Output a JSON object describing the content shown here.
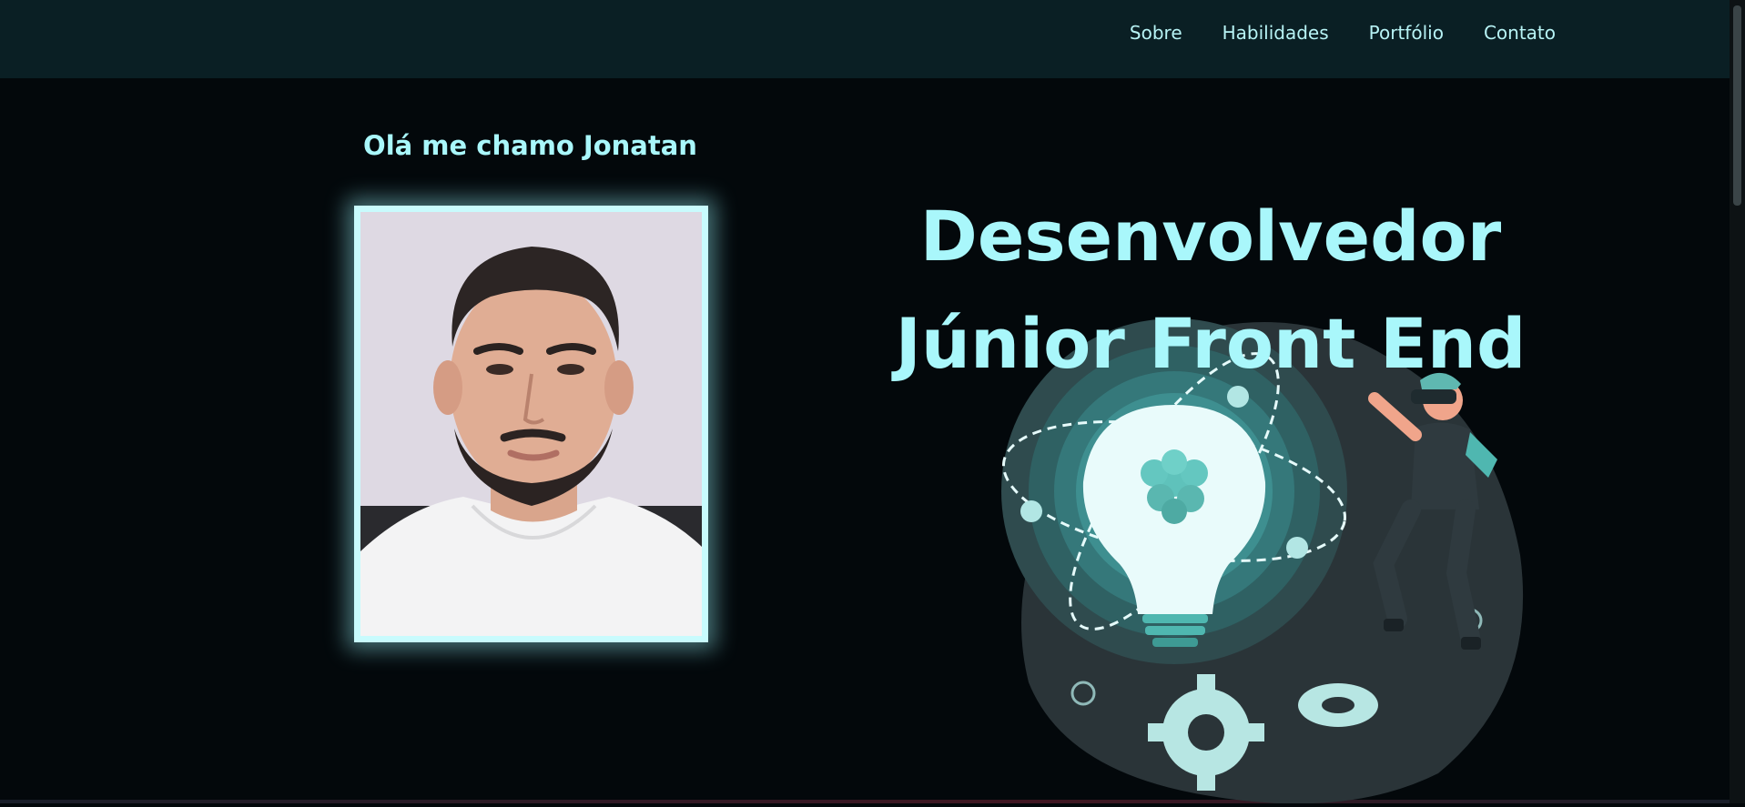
{
  "nav": {
    "items": [
      {
        "label": "Sobre"
      },
      {
        "label": "Habilidades"
      },
      {
        "label": "Portfólio"
      },
      {
        "label": "Contato"
      }
    ]
  },
  "hero": {
    "greeting": "Olá me chamo Jonatan",
    "headline_line1": "Desenvolvedor",
    "headline_line2": "Júnior Front End"
  },
  "colors": {
    "accent": "#a9f7fb",
    "background": "#03080b",
    "navbar": "#0a1f24"
  }
}
